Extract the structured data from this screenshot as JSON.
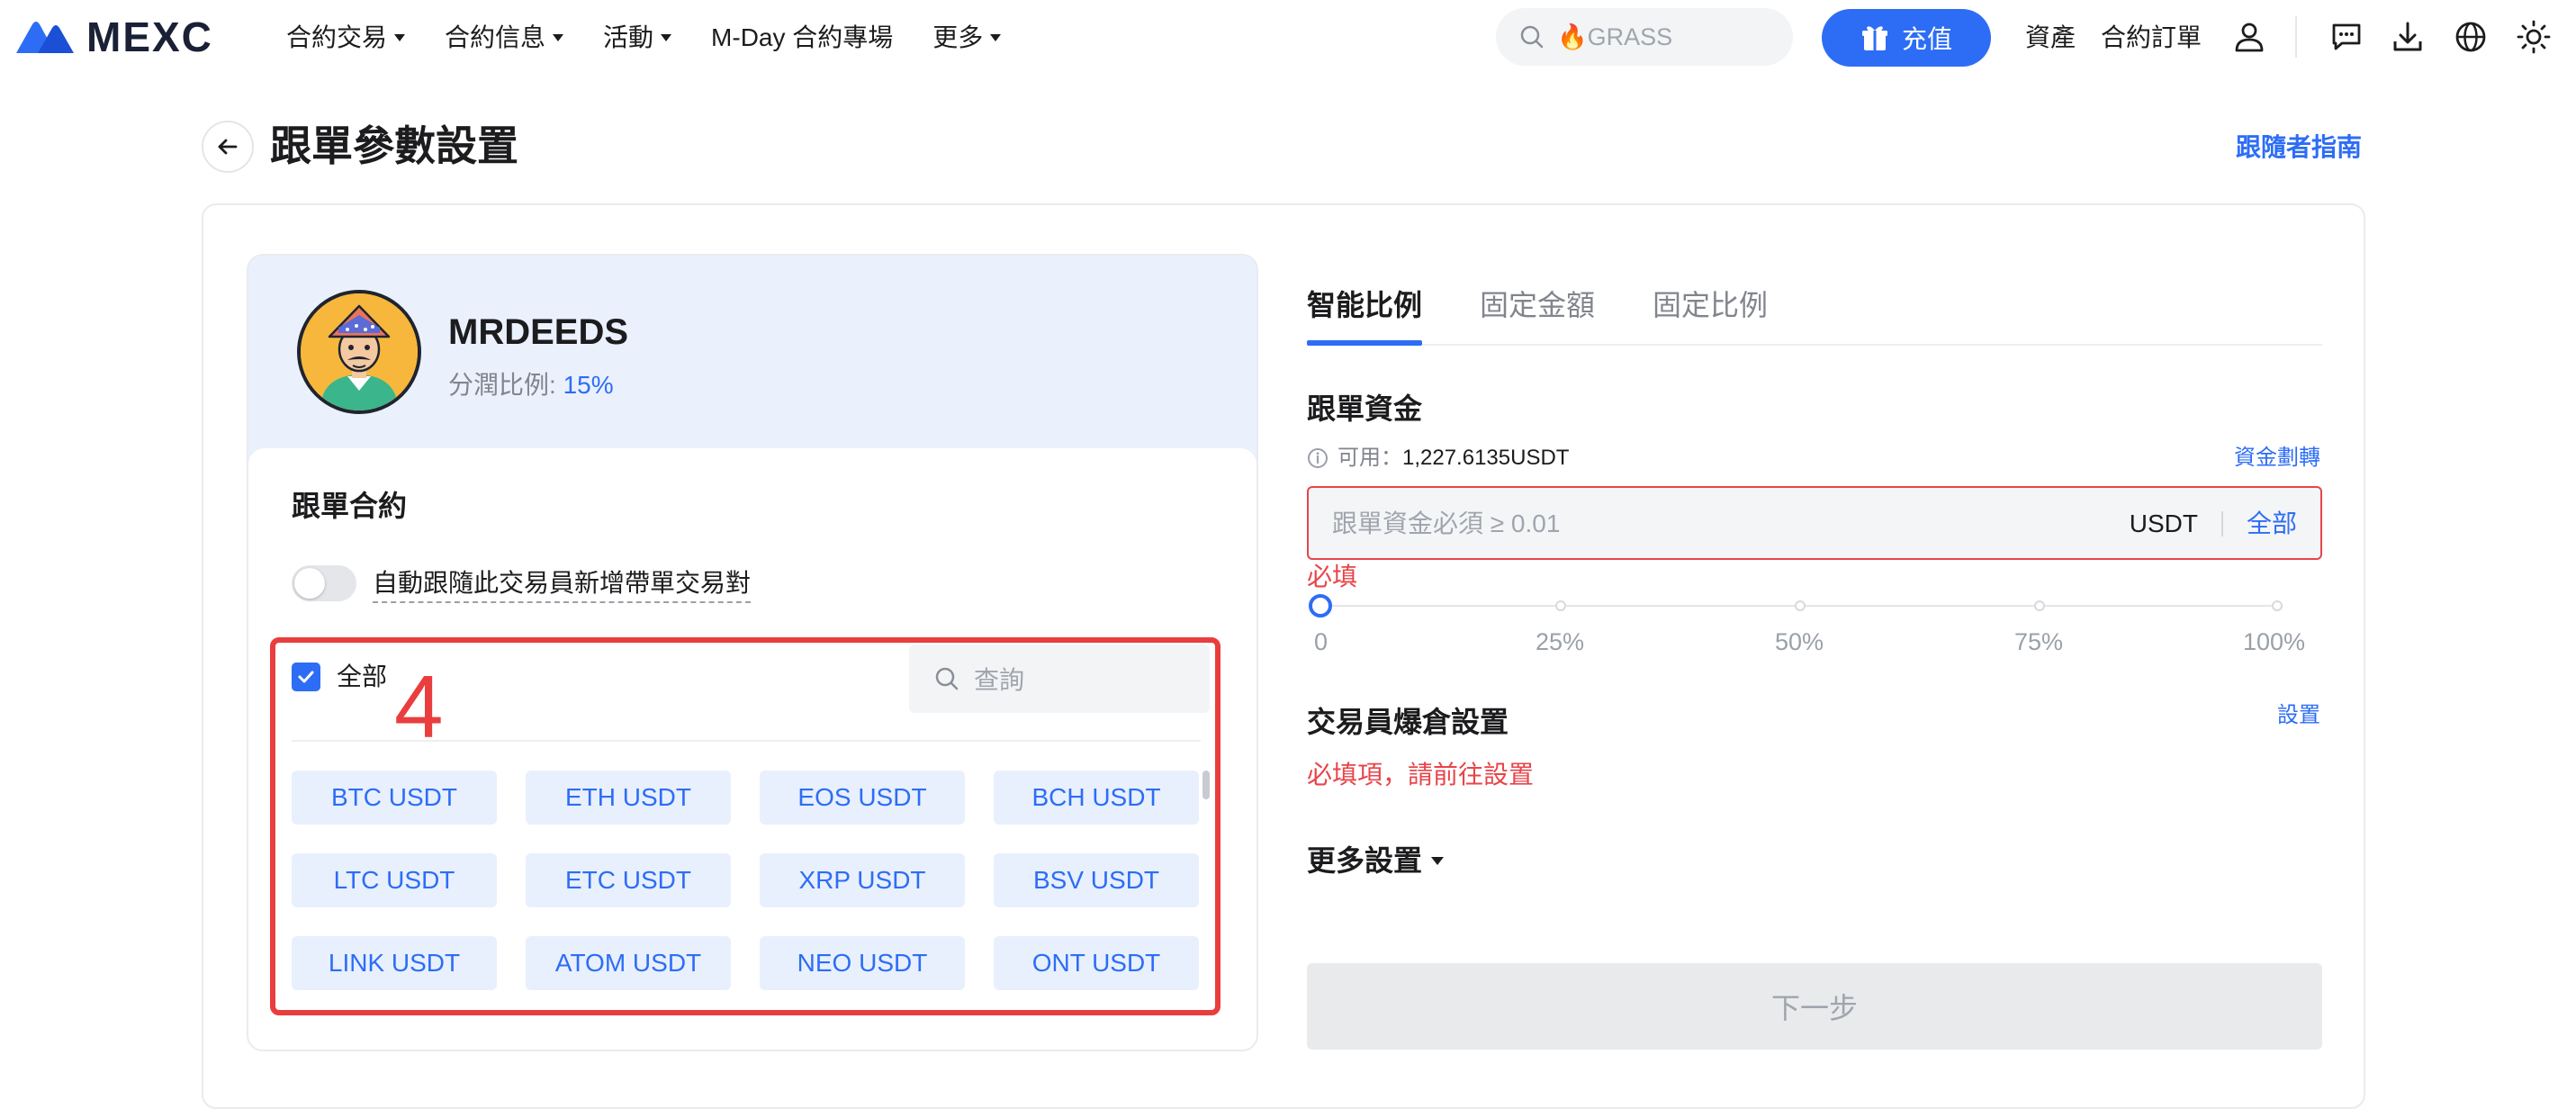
{
  "nav": {
    "logo_text": "MEXC",
    "menu": [
      {
        "label": "合約交易",
        "has_caret": true
      },
      {
        "label": "合約信息",
        "has_caret": true
      },
      {
        "label": "活動",
        "has_caret": true
      },
      {
        "label": "M-Day 合約專場",
        "has_caret": false
      },
      {
        "label": "更多",
        "has_caret": true
      }
    ],
    "search_placeholder": "🔥GRASS",
    "deposit_label": "充值",
    "assets_label": "資產",
    "orders_label": "合約訂單",
    "icons": [
      "user-icon",
      "message-icon",
      "download-icon",
      "globe-icon",
      "theme-sun-icon"
    ]
  },
  "page": {
    "title": "跟單參數設置",
    "guide_link": "跟隨者指南"
  },
  "trader": {
    "name": "MRDEEDS",
    "share_label": "分潤比例: ",
    "share_value": "15%"
  },
  "contracts": {
    "title": "跟單合約",
    "auto_follow_label": "自動跟隨此交易員新增帶單交易對",
    "auto_follow_on": false,
    "select_all_label": "全部",
    "select_all_checked": true,
    "step_number": "4",
    "search_placeholder": "查詢",
    "pairs": [
      "BTC USDT",
      "ETH USDT",
      "EOS USDT",
      "BCH USDT",
      "LTC USDT",
      "ETC USDT",
      "XRP USDT",
      "BSV USDT",
      "LINK USDT",
      "ATOM USDT",
      "NEO USDT",
      "ONT USDT"
    ]
  },
  "tabs": {
    "items": [
      "智能比例",
      "固定金額",
      "固定比例"
    ],
    "active_index": 0
  },
  "fund": {
    "title": "跟單資金",
    "available_label": "可用：",
    "available_value": "1,227.6135USDT",
    "transfer_link": "資金劃轉",
    "input_placeholder": "跟單資金必須 ≥ 0.01",
    "unit": "USDT",
    "all_label": "全部",
    "required_text": "必填",
    "slider_value_percent": 0,
    "slider_marks": [
      "0",
      "25%",
      "50%",
      "75%",
      "100%"
    ]
  },
  "liquidation": {
    "title": "交易員爆倉設置",
    "set_link": "設置",
    "required_text": "必填項，請前往設置"
  },
  "more_settings_label": "更多設置",
  "next_button_label": "下一步",
  "colors": {
    "accent": "#2d6df6",
    "error": "#e8444a",
    "highlight_frame": "#ea3d3d",
    "trader_bg": "#eaf1fd",
    "chip_bg": "#e8f0fd"
  }
}
